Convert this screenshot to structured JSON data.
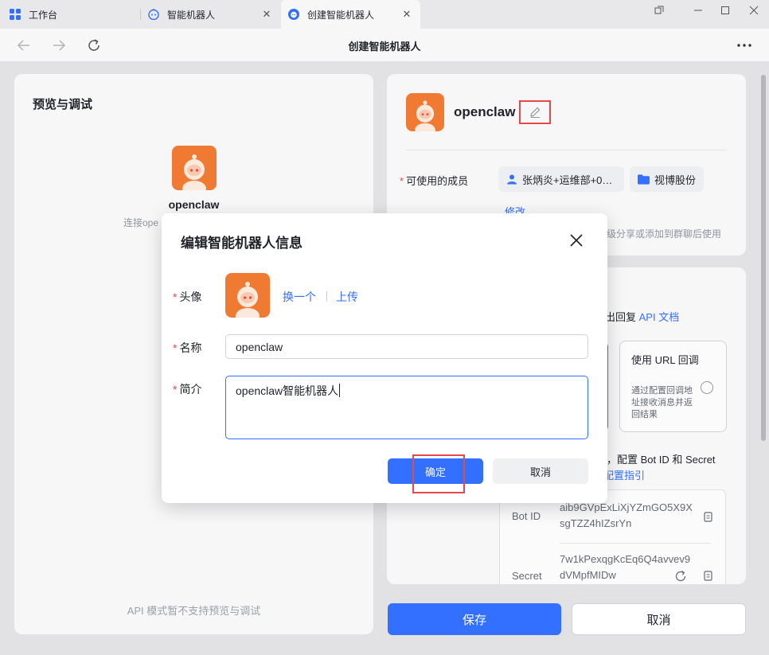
{
  "tabs": [
    {
      "label": "工作台",
      "icon": "grid-icon"
    },
    {
      "label": "智能机器人",
      "icon": "robot-icon"
    },
    {
      "label": "创建智能机器人",
      "icon": "robot-icon"
    }
  ],
  "nav": {
    "title": "创建智能机器人"
  },
  "preview": {
    "title": "预览与调试",
    "bot_name": "openclaw",
    "desc": "连接ope",
    "api_note": "API 模式暂不支持预览与调试"
  },
  "bot_info": {
    "name": "openclaw",
    "members_label": "可使用的成员",
    "member_chip": "张炳炎+运维部+0…",
    "org_chip": "视博股份",
    "modify": "修改",
    "share_note": "级分享或添加到群聊后使用"
  },
  "config": {
    "reply_text": "出回复 ",
    "api_doc": "API 文档",
    "url_card_title": "使用 URL 回调",
    "url_card_desc": "通过配置回调地址接收消息并返回结果",
    "bot_secret_hint": "，配置 Bot ID 和 Secret",
    "guide_link": "配置指引",
    "bot_id_label": "Bot ID",
    "bot_id_value": "aib9GVpExLiXjYZmGO5X9XsgTZZ4hIZsrYn",
    "secret_label": "Secret",
    "secret_value": "7w1kPexqgKcEq6Q4avvev9dVMpfMIDw"
  },
  "footer": {
    "save": "保存",
    "cancel": "取消"
  },
  "dialog": {
    "title": "编辑智能机器人信息",
    "avatar_label": "头像",
    "change_link": "换一个",
    "upload_link": "上传",
    "name_label": "名称",
    "name_value": "openclaw",
    "desc_label": "简介",
    "desc_value": "openclaw智能机器人",
    "confirm": "确定",
    "cancel": "取消"
  },
  "colors": {
    "accent": "#3370ff",
    "highlight": "#e8474c",
    "avatar_bg": "#f07a32"
  }
}
